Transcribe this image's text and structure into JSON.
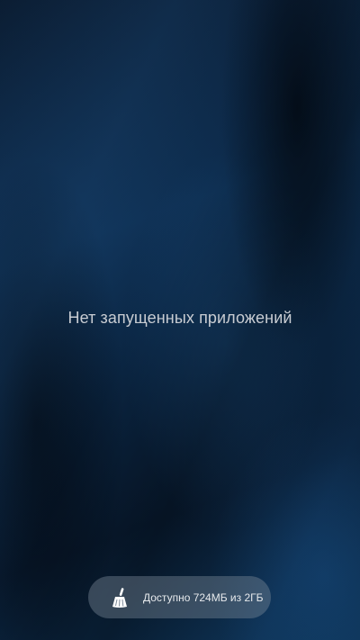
{
  "recents": {
    "empty_message": "Нет запущенных приложений"
  },
  "memory_button": {
    "label": "Доступно 724МБ из 2ГБ",
    "icon": "broom-icon"
  },
  "colors": {
    "background": "#0b1d33",
    "text": "#c8ccd2",
    "pill": "#7d8a98"
  }
}
